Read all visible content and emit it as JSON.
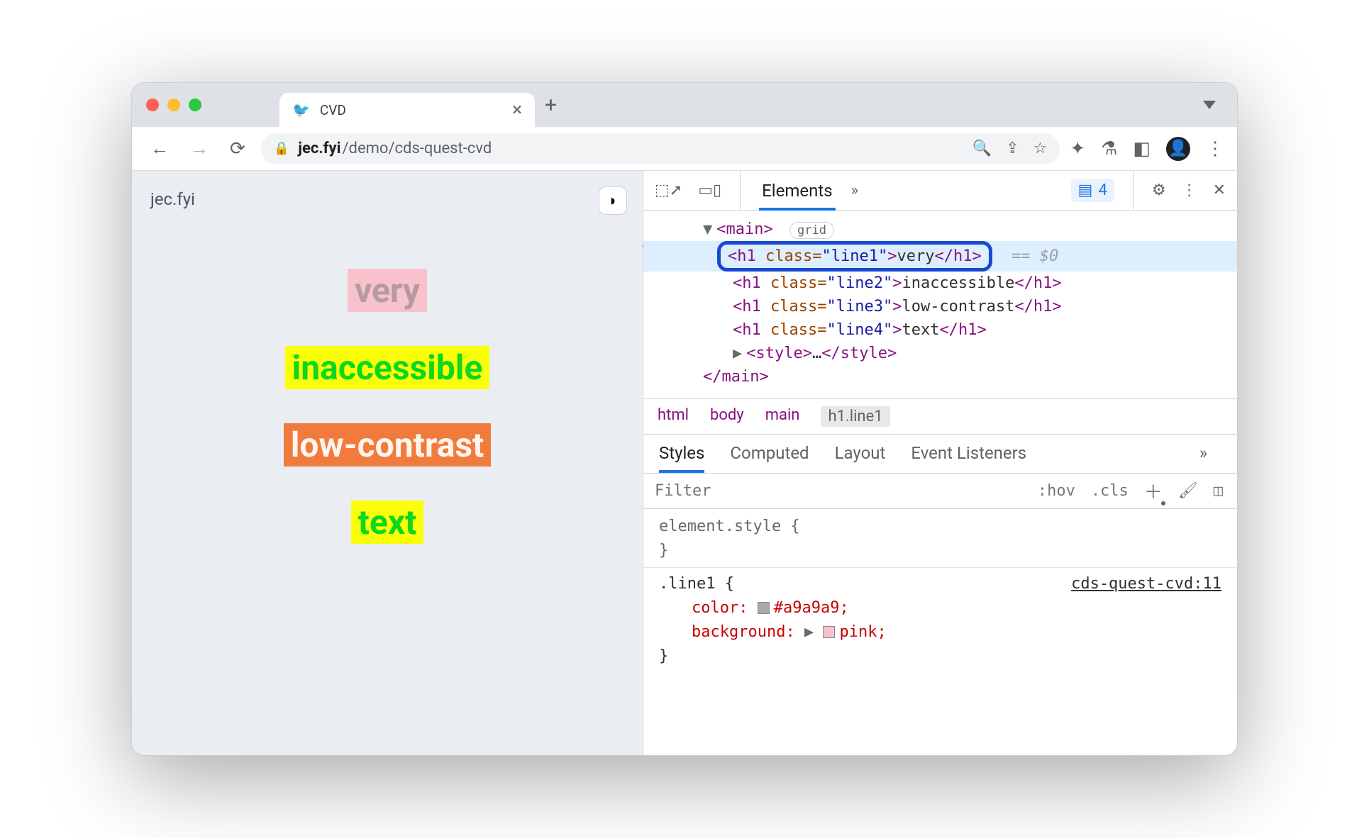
{
  "browser": {
    "tab_title": "CVD",
    "favicon": "🐦",
    "url_host": "jec.fyi",
    "url_path": "/demo/cds-quest-cvd",
    "issues_count": "4"
  },
  "page": {
    "origin": "jec.fyi",
    "lines": {
      "l1": "very",
      "l2": "inaccessible",
      "l3": "low-contrast",
      "l4": "text"
    }
  },
  "devtools": {
    "top_tab": "Elements",
    "grid_chip": "grid",
    "main_open": "main",
    "nodes": {
      "line1": {
        "tag": "h1",
        "cls": "line1",
        "text": "very"
      },
      "line2": {
        "tag": "h1",
        "cls": "line2",
        "text": "inaccessible"
      },
      "line3": {
        "tag": "h1",
        "cls": "line3",
        "text": "low-contrast"
      },
      "line4": {
        "tag": "h1",
        "cls": "line4",
        "text": "text"
      },
      "style_stub": "style"
    },
    "sel_suffix": "== $0",
    "crumbs": {
      "c1": "html",
      "c2": "body",
      "c3": "main",
      "c4": "h1.line1"
    },
    "subtabs": {
      "s1": "Styles",
      "s2": "Computed",
      "s3": "Layout",
      "s4": "Event Listeners"
    },
    "filter_placeholder": "Filter",
    "hov": ":hov",
    "cls": ".cls",
    "rules": {
      "elstyle": "element.style {",
      "close": "}",
      "sel1": ".line1 {",
      "src1": "cds-quest-cvd:11",
      "p1": "color",
      "v1": "#a9a9a9",
      "sw1": "#a9a9a9",
      "p2": "background",
      "v2": "pink",
      "sw2": "#f7c2cc"
    }
  }
}
